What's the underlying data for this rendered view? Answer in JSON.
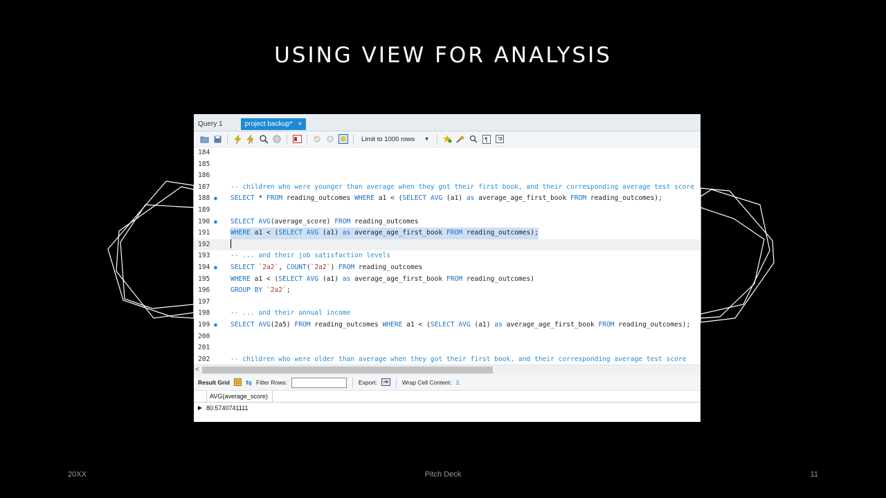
{
  "slide": {
    "title": "USING VIEW FOR ANALYSIS",
    "footer_left": "20XX",
    "footer_center": "Pitch Deck",
    "footer_right": "11"
  },
  "tabs": [
    {
      "label": "Query 1"
    },
    {
      "label": "project backup*",
      "close": "×"
    }
  ],
  "toolbar": {
    "limit_label": "Limit to 1000 rows",
    "icons": [
      "open-folder-icon",
      "save-icon",
      "execute-icon",
      "execute-current-icon",
      "explain-icon",
      "stop-icon",
      "toggle-output-icon",
      "commit-icon",
      "rollback-icon",
      "autocommit-icon",
      "bookmark-icon",
      "beautify-icon",
      "find-icon",
      "invisible-chars-icon",
      "wrap-icon"
    ]
  },
  "editor": {
    "lines": [
      {
        "n": "184",
        "text": ""
      },
      {
        "n": "185",
        "text": ""
      },
      {
        "n": "186",
        "text": ""
      },
      {
        "n": "187",
        "text": "-- children who were younger than average when they got their first book, and their corresponding average test score"
      },
      {
        "n": "188",
        "text": "SELECT * FROM reading_outcomes WHERE a1 < (SELECT AVG (a1) as average_age_first_book FROM reading_outcomes);"
      },
      {
        "n": "189",
        "text": ""
      },
      {
        "n": "190",
        "text": "SELECT AVG(average_score) FROM reading_outcomes"
      },
      {
        "n": "191",
        "text": "WHERE a1 < (SELECT AVG (a1) as average_age_first_book FROM reading_outcomes);"
      },
      {
        "n": "192",
        "text": ""
      },
      {
        "n": "193",
        "text": "-- ... and their job satisfaction levels"
      },
      {
        "n": "194",
        "text": "SELECT `2a2`, COUNT(`2a2`) FROM reading_outcomes"
      },
      {
        "n": "195",
        "text": "WHERE a1 < (SELECT AVG (a1) as average_age_first_book FROM reading_outcomes)"
      },
      {
        "n": "196",
        "text": "GROUP BY `2a2`;"
      },
      {
        "n": "197",
        "text": ""
      },
      {
        "n": "198",
        "text": "-- ... and their annual income"
      },
      {
        "n": "199",
        "text": "SELECT AVG(2a5) FROM reading_outcomes WHERE a1 < (SELECT AVG (a1) as average_age_first_book FROM reading_outcomes);"
      },
      {
        "n": "200",
        "text": ""
      },
      {
        "n": "201",
        "text": ""
      },
      {
        "n": "202",
        "text": "-- children who were older than average when they got their first book, and their corresponding average test score"
      }
    ]
  },
  "result_bar": {
    "result_grid": "Result Grid",
    "filter_rows": "Filter Rows:",
    "export": "Export:",
    "wrap_cell": "Wrap Cell Content:"
  },
  "result_grid": {
    "columns": [
      "AVG(average_score)"
    ],
    "rows": [
      [
        "80.5740741111"
      ]
    ]
  },
  "colors": {
    "accent": "#1c8ad6",
    "comment": "#2a8bd5",
    "keyword": "#1c6fc5",
    "selection": "#cde0f4"
  }
}
